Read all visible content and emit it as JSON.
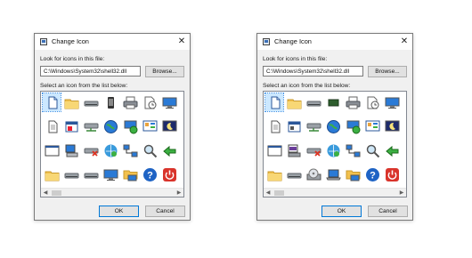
{
  "dialogs": [
    {
      "title": "Change Icon",
      "close_glyph": "✕",
      "look_label": "Look for icons in this file:",
      "path_value": "C:\\Windows\\System32\\shell32.dll",
      "browse_label": "Browse...",
      "select_label": "Select an icon from the list below:",
      "ok_label": "OK",
      "cancel_label": "Cancel",
      "scroll_left": "◀",
      "scroll_right": "▶",
      "icons": [
        [
          "blank-document",
          "folder",
          "drive",
          "phone",
          "printer",
          "clock-document",
          "monitor",
          "partial-icon"
        ],
        [
          "document",
          "calendar-window",
          "network-drive",
          "globe",
          "network-computer",
          "control-panel",
          "moon",
          "partial-icon"
        ],
        [
          "window",
          "computer",
          "removed-drive",
          "network-globe",
          "network",
          "magnifier",
          "recycle-arrow",
          "partial-icon"
        ],
        [
          "folder",
          "drive",
          "drive",
          "monitor",
          "network-folder",
          "help",
          "power",
          "partial-icon"
        ]
      ]
    },
    {
      "title": "Change Icon",
      "close_glyph": "✕",
      "look_label": "Look for icons in this file:",
      "path_value": "C:\\Windows\\System32\\shell32.dll",
      "browse_label": "Browse...",
      "select_label": "Select an icon from the list below:",
      "ok_label": "OK",
      "cancel_label": "Cancel",
      "scroll_left": "◀",
      "scroll_right": "▶",
      "icons": [
        [
          "blank-document",
          "folder",
          "drive",
          "chip",
          "printer",
          "clock-document",
          "monitor",
          "partial-icon"
        ],
        [
          "document",
          "card-window",
          "network-drive",
          "globe",
          "network-computer",
          "control-panel",
          "moon",
          "partial-icon"
        ],
        [
          "window",
          "drive-stack",
          "removed-drive",
          "network-globe",
          "network",
          "magnifier",
          "recycle-arrow",
          "partial-icon"
        ],
        [
          "folder",
          "drive",
          "cd-drive",
          "laptop",
          "network-folder",
          "help",
          "power",
          "partial-icon"
        ]
      ]
    }
  ]
}
